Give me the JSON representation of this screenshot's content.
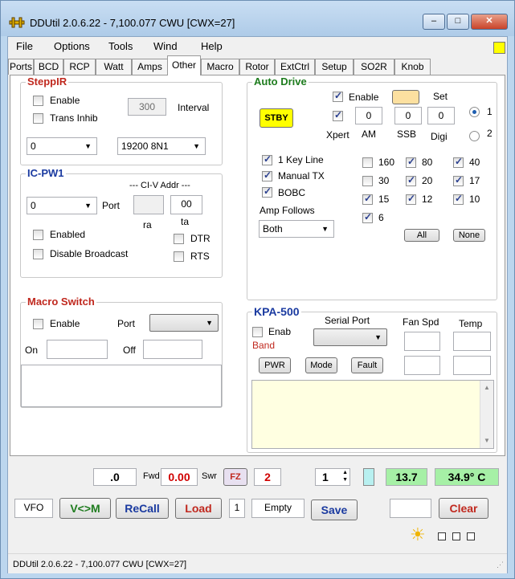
{
  "window": {
    "title": "DDUtil 2.0.6.22 - 7,100.077  CWU  [CWX=27]",
    "minimize": "–",
    "maximize": "□",
    "close": "✕"
  },
  "menu": [
    "File",
    "Options",
    "Tools",
    "Wind",
    "Help"
  ],
  "tabs": [
    "Ports",
    "BCD",
    "RCP",
    "Watt",
    "Amps",
    "Other",
    "Macro",
    "Rotor",
    "ExtCtrl",
    "Setup",
    "SO2R",
    "Knob"
  ],
  "active_tab": "Other",
  "steppir": {
    "title": "SteppIR",
    "enable": "Enable",
    "trans_inhib": "Trans Inhib",
    "interval_value": "300",
    "interval_label": "Interval",
    "port_value": "0",
    "baud_value": "19200 8N1"
  },
  "icpw1": {
    "title": "IC-PW1",
    "civ_label": "--- CI-V Addr ---",
    "port_value": "0",
    "port_label": "Port",
    "addr_value": "00",
    "ra_label": "ra",
    "ta_label": "ta",
    "enabled": "Enabled",
    "dtr": "DTR",
    "disable_broadcast": "Disable Broadcast",
    "rts": "RTS"
  },
  "macro_switch": {
    "title": "Macro Switch",
    "enable": "Enable",
    "port_label": "Port",
    "on_label": "On",
    "off_label": "Off"
  },
  "auto_drive": {
    "title": "Auto Drive",
    "stby": "STBY",
    "enable": "Enable",
    "set": "Set",
    "xpert": "Xpert",
    "am": "AM",
    "ssb": "SSB",
    "digi": "Digi",
    "am_val": "0",
    "ssb_val": "0",
    "digi_val": "0",
    "radio1": "1",
    "radio2": "2",
    "one_key_line": "1 Key Line",
    "manual_tx": "Manual TX",
    "bobc": "BOBC",
    "amp_follows_label": "Amp Follows",
    "amp_follows_value": "Both",
    "bands": [
      "160",
      "80",
      "40",
      "30",
      "20",
      "17",
      "15",
      "12",
      "10",
      "6"
    ],
    "band_checked": [
      false,
      true,
      true,
      false,
      true,
      true,
      true,
      true,
      true,
      true
    ],
    "all": "All",
    "none": "None"
  },
  "kpa500": {
    "title": "KPA-500",
    "enab": "Enab",
    "band": "Band",
    "serial_port": "Serial Port",
    "fan_spd": "Fan Spd",
    "temp": "Temp",
    "pwr": "PWR",
    "mode": "Mode",
    "fault": "Fault"
  },
  "bottom": {
    "fwd_value": ".0",
    "fwd_label": "Fwd",
    "swr_value": "0.00",
    "swr_label": "Swr",
    "fz": "FZ",
    "fz_value": "2",
    "spin_value": "1",
    "voltage": "13.7",
    "temperature": "34.9° C",
    "vfo": "VFO",
    "vm": "V<>M",
    "recall": "ReCall",
    "load": "Load",
    "mem_num": "1",
    "mem_status": "Empty",
    "save": "Save",
    "clear": "Clear",
    "sun_icon": "☀"
  },
  "status": {
    "text": "DDUtil 2.0.6.22 - 7,100.077  CWU  [CWX=27]"
  },
  "colors": {
    "stby": "#ffff00",
    "green_ind": "#a6f0a6",
    "set_btn": "#fce0a0",
    "kpa_memo": "#ffffe1",
    "accent_red": "#c0281e"
  }
}
